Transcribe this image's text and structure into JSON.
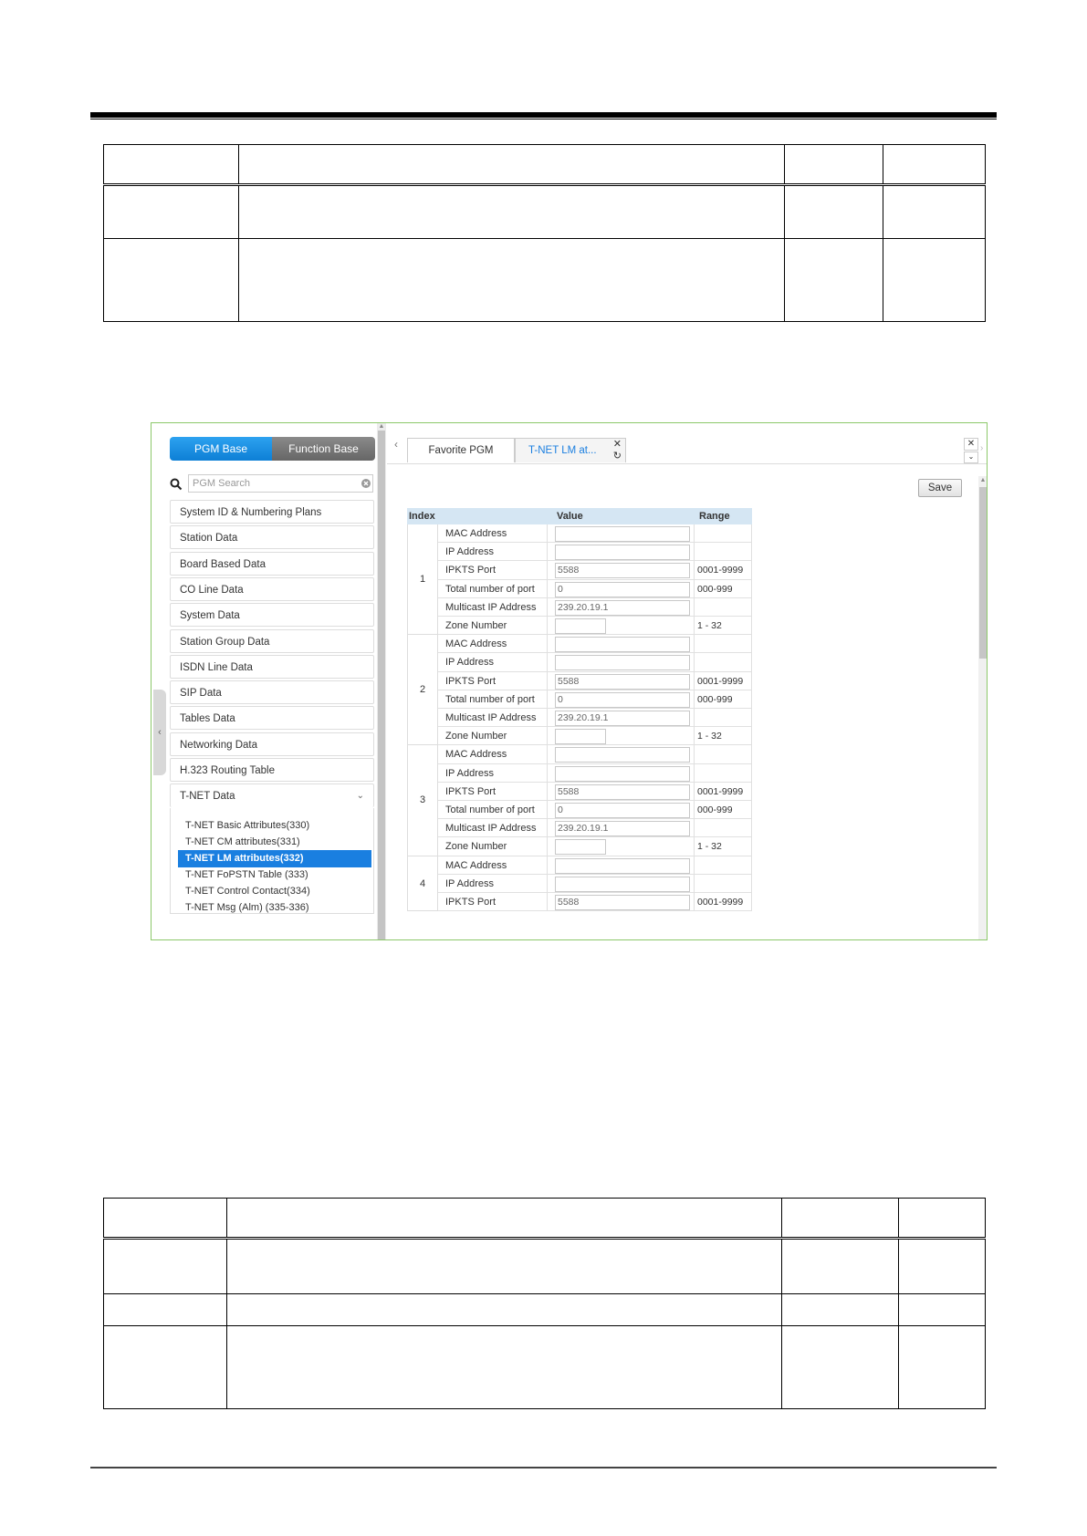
{
  "left_panel": {
    "pgm_base_label": "PGM Base",
    "function_base_label": "Function Base",
    "search_placeholder": "PGM Search",
    "menu": [
      "System ID & Numbering Plans",
      "Station Data",
      "Board Based Data",
      "CO Line Data",
      "System Data",
      "Station Group Data",
      "ISDN Line Data",
      "SIP Data",
      "Tables Data",
      "Networking Data",
      "H.323 Routing Table",
      "T-NET Data"
    ],
    "tnet_submenu": [
      "T-NET Basic Attributes(330)",
      "T-NET CM attributes(331)",
      "T-NET LM attributes(332)",
      "T-NET FoPSTN Table (333)",
      "T-NET Control Contact(334)",
      "T-NET Msg (Alm) (335-336)"
    ],
    "active_submenu_index": 2
  },
  "right_panel": {
    "tabs": [
      "Favorite PGM",
      "T-NET LM at..."
    ],
    "active_tab_index": 1,
    "save_label": "Save",
    "grid": {
      "headers": {
        "index": "Index",
        "value": "Value",
        "range": "Range"
      },
      "groups": [
        {
          "index": "1",
          "rows": [
            {
              "label": "MAC Address",
              "value": "",
              "range": ""
            },
            {
              "label": "IP Address",
              "value": "",
              "range": ""
            },
            {
              "label": "IPKTS Port",
              "value": "5588",
              "range": "0001-9999"
            },
            {
              "label": "Total number of port",
              "value": "0",
              "range": "000-999"
            },
            {
              "label": "Multicast IP Address",
              "value": "239.20.19.1",
              "range": ""
            },
            {
              "label": "Zone Number",
              "value": "",
              "range": "1 - 32",
              "short": true
            }
          ]
        },
        {
          "index": "2",
          "rows": [
            {
              "label": "MAC Address",
              "value": "",
              "range": ""
            },
            {
              "label": "IP Address",
              "value": "",
              "range": ""
            },
            {
              "label": "IPKTS Port",
              "value": "5588",
              "range": "0001-9999"
            },
            {
              "label": "Total number of port",
              "value": "0",
              "range": "000-999"
            },
            {
              "label": "Multicast IP Address",
              "value": "239.20.19.1",
              "range": ""
            },
            {
              "label": "Zone Number",
              "value": "",
              "range": "1 - 32",
              "short": true
            }
          ]
        },
        {
          "index": "3",
          "rows": [
            {
              "label": "MAC Address",
              "value": "",
              "range": ""
            },
            {
              "label": "IP Address",
              "value": "",
              "range": ""
            },
            {
              "label": "IPKTS Port",
              "value": "5588",
              "range": "0001-9999"
            },
            {
              "label": "Total number of port",
              "value": "0",
              "range": "000-999"
            },
            {
              "label": "Multicast IP Address",
              "value": "239.20.19.1",
              "range": ""
            },
            {
              "label": "Zone Number",
              "value": "",
              "range": "1 - 32",
              "short": true
            }
          ]
        },
        {
          "index": "4",
          "rows": [
            {
              "label": "MAC Address",
              "value": "",
              "range": ""
            },
            {
              "label": "IP Address",
              "value": "",
              "range": ""
            },
            {
              "label": "IPKTS Port",
              "value": "5588",
              "range": "0001-9999"
            }
          ]
        }
      ]
    }
  },
  "colors": {
    "frame_border": "#8cc86a",
    "pgm_base_blue": "#1a8ae6",
    "function_base_gray": "#777777",
    "active_item_blue": "#1a7fe0",
    "grid_header_bg": "#d5e6f3"
  }
}
